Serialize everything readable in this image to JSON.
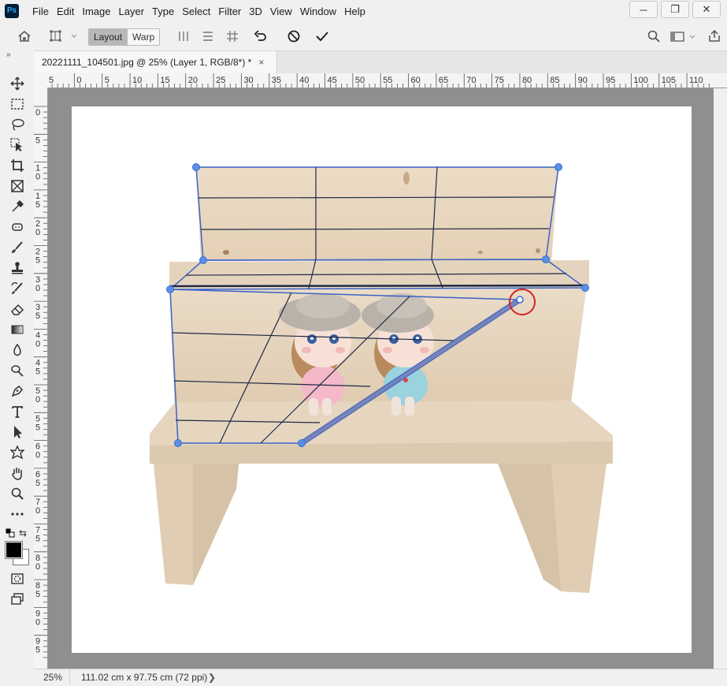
{
  "app": {
    "logo": "Ps"
  },
  "menubar": {
    "items": [
      "File",
      "Edit",
      "Image",
      "Layer",
      "Type",
      "Select",
      "Filter",
      "3D",
      "View",
      "Window",
      "Help"
    ]
  },
  "window_controls": {
    "minimize": "─",
    "restore": "❐",
    "close": "✕"
  },
  "options": {
    "modes": [
      "Layout",
      "Warp"
    ],
    "active_mode": "Layout",
    "icons": [
      "home-icon",
      "perspective-warp-icon",
      "vertical-straighten-icon",
      "horizontal-straighten-icon",
      "grid-icon",
      "undo-icon",
      "cancel-icon",
      "commit-icon",
      "search-icon",
      "workspace-icon",
      "share-icon"
    ]
  },
  "document_tab": {
    "label": "20221111_104501.jpg @ 25% (Layer 1, RGB/8*) *",
    "close": "×"
  },
  "rulers": {
    "top": [
      "5",
      "0",
      "5",
      "10",
      "15",
      "20",
      "25",
      "30",
      "35",
      "40",
      "45",
      "50",
      "55",
      "60",
      "65",
      "70",
      "75",
      "80",
      "85",
      "90",
      "95",
      "100",
      "105",
      "110"
    ],
    "left": [
      "0",
      "5",
      "1\n0",
      "1\n5",
      "2\n0",
      "2\n5",
      "3\n0",
      "3\n5",
      "4\n0",
      "4\n5",
      "5\n0",
      "5\n5",
      "6\n0",
      "6\n5",
      "7\n0",
      "7\n5",
      "8\n0",
      "8\n5",
      "9\n0",
      "9\n5"
    ]
  },
  "tools": [
    "move-tool-icon",
    "marquee-tool-icon",
    "lasso-tool-icon",
    "object-select-tool-icon",
    "crop-tool-icon",
    "frame-tool-icon",
    "eyedropper-tool-icon",
    "healing-tool-icon",
    "brush-tool-icon",
    "stamp-tool-icon",
    "history-brush-icon",
    "eraser-tool-icon",
    "gradient-tool-icon",
    "blur-tool-icon",
    "dodge-tool-icon",
    "pen-tool-icon",
    "type-tool-icon",
    "path-select-tool-icon",
    "shape-tool-icon",
    "hand-tool-icon",
    "zoom-tool-icon",
    "more-tools-icon"
  ],
  "colors": {
    "foreground": "#000000",
    "background": "#ffffff",
    "accent": "#4a7fd9",
    "handle_highlight": "#d42020"
  },
  "status": {
    "zoom": "25%",
    "dimensions": "111.02 cm x 97.75 cm (72 ppi)",
    "arrow": "❯"
  }
}
